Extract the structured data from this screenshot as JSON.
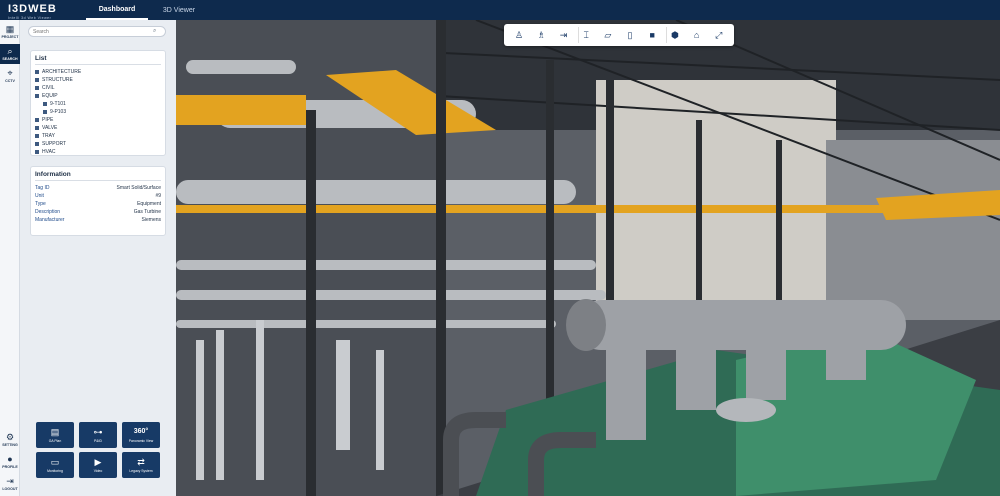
{
  "app": {
    "brand": "I3DWEB",
    "subtitle": "Intelli 3d Web Viewer"
  },
  "nav": {
    "tabs": [
      {
        "label": "Dashboard",
        "active": true
      },
      {
        "label": "3D Viewer",
        "active": false
      }
    ]
  },
  "rail": {
    "top": [
      {
        "label": "PROJECT",
        "icon": "building-icon"
      },
      {
        "label": "SEARCH",
        "icon": "search-icon",
        "active": true
      },
      {
        "label": "CCTV",
        "icon": "cctv-icon"
      }
    ],
    "bottom": [
      {
        "label": "SETTING",
        "icon": "gear-icon"
      },
      {
        "label": "PROFILE",
        "icon": "user-icon"
      },
      {
        "label": "LOGOUT",
        "icon": "logout-icon"
      }
    ]
  },
  "search": {
    "placeholder": "Search"
  },
  "list": {
    "title": "List",
    "items": [
      {
        "label": "ARCHITECTURE",
        "level": 0
      },
      {
        "label": "STRUCTURE",
        "level": 0
      },
      {
        "label": "CIVIL",
        "level": 0
      },
      {
        "label": "EQUIP",
        "level": 0
      },
      {
        "label": "9-T101",
        "level": 1
      },
      {
        "label": "9-P103",
        "level": 1
      },
      {
        "label": "PIPE",
        "level": 0
      },
      {
        "label": "VALVE",
        "level": 0
      },
      {
        "label": "TRAY",
        "level": 0
      },
      {
        "label": "SUPPORT",
        "level": 0
      },
      {
        "label": "HVAC",
        "level": 0
      }
    ]
  },
  "information": {
    "title": "Information",
    "rows": [
      {
        "key": "Tag ID",
        "value": "Smart Solid/Surface"
      },
      {
        "key": "Unit",
        "value": "#9"
      },
      {
        "key": "Type",
        "value": "Equipment"
      },
      {
        "key": "Description",
        "value": "Gas Turbine"
      },
      {
        "key": "Manufacturer",
        "value": "Siemens"
      }
    ]
  },
  "tiles": [
    {
      "label": "GA Plan",
      "icon": "ga-plan-icon"
    },
    {
      "label": "P&ID",
      "icon": "pid-icon"
    },
    {
      "label": "Panoramic View",
      "icon": "panorama-360-icon"
    },
    {
      "label": "Monitoring",
      "icon": "monitoring-icon"
    },
    {
      "label": "Video",
      "icon": "video-icon"
    },
    {
      "label": "Legacy System",
      "icon": "legacy-system-icon"
    }
  ],
  "toolbar": {
    "tools": [
      {
        "name": "walk-mode-icon",
        "glyph": "♙"
      },
      {
        "name": "person-view-icon",
        "glyph": "♗"
      },
      {
        "name": "measure-point-icon",
        "glyph": "⇥"
      },
      {
        "name": "measure-distance-icon",
        "glyph": "⌶"
      },
      {
        "name": "section-plane-icon",
        "glyph": "▱"
      },
      {
        "name": "section-box-icon",
        "glyph": "▯"
      },
      {
        "name": "solid-mode-icon",
        "glyph": "■"
      },
      {
        "name": "cube-view-icon",
        "glyph": "⬢"
      },
      {
        "name": "hierarchy-icon",
        "glyph": "⌂"
      },
      {
        "name": "fullscreen-icon",
        "glyph": "⤢"
      }
    ]
  },
  "scene": {
    "colors": {
      "steel": "#3b3f45",
      "pipe": "#b9bcc0",
      "grating": "#e3a320",
      "turbine": "#3f8f6b",
      "floor": "#2f6b55",
      "cladding": "#d8d5cf"
    }
  }
}
